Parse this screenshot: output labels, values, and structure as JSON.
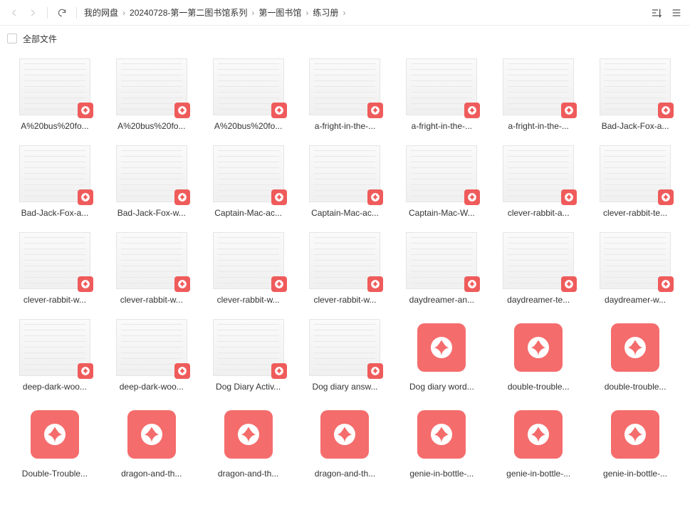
{
  "breadcrumb": {
    "root": "我的网盘",
    "p1": "20240728-第一第二图书馆系列",
    "p2": "第一图书馆",
    "p3": "练习册"
  },
  "selectbar": {
    "all_label": "全部文件"
  },
  "files": [
    {
      "name": "A%20bus%20fo...",
      "thumb": true
    },
    {
      "name": "A%20bus%20fo...",
      "thumb": true
    },
    {
      "name": "A%20bus%20fo...",
      "thumb": true
    },
    {
      "name": "a-fright-in-the-...",
      "thumb": true
    },
    {
      "name": "a-fright-in-the-...",
      "thumb": true
    },
    {
      "name": "a-fright-in-the-...",
      "thumb": true
    },
    {
      "name": "Bad-Jack-Fox-a...",
      "thumb": true
    },
    {
      "name": "Bad-Jack-Fox-a...",
      "thumb": true
    },
    {
      "name": "Bad-Jack-Fox-w...",
      "thumb": true
    },
    {
      "name": "Captain-Mac-ac...",
      "thumb": true
    },
    {
      "name": "Captain-Mac-ac...",
      "thumb": true
    },
    {
      "name": "Captain-Mac-W...",
      "thumb": true
    },
    {
      "name": "clever-rabbit-a...",
      "thumb": true
    },
    {
      "name": "clever-rabbit-te...",
      "thumb": true
    },
    {
      "name": "clever-rabbit-w...",
      "thumb": true
    },
    {
      "name": "clever-rabbit-w...",
      "thumb": true
    },
    {
      "name": "clever-rabbit-w...",
      "thumb": true
    },
    {
      "name": "clever-rabbit-w...",
      "thumb": true
    },
    {
      "name": "daydreamer-an...",
      "thumb": true
    },
    {
      "name": "daydreamer-te...",
      "thumb": true
    },
    {
      "name": "daydreamer-w...",
      "thumb": true
    },
    {
      "name": "deep-dark-woo...",
      "thumb": true
    },
    {
      "name": "deep-dark-woo...",
      "thumb": true
    },
    {
      "name": "Dog Diary Activ...",
      "thumb": true
    },
    {
      "name": "Dog diary answ...",
      "thumb": true
    },
    {
      "name": "Dog diary word...",
      "thumb": false
    },
    {
      "name": "double-trouble...",
      "thumb": false
    },
    {
      "name": "double-trouble...",
      "thumb": false
    },
    {
      "name": "Double-Trouble...",
      "thumb": false
    },
    {
      "name": "dragon-and-th...",
      "thumb": false
    },
    {
      "name": "dragon-and-th...",
      "thumb": false
    },
    {
      "name": "dragon-and-th...",
      "thumb": false
    },
    {
      "name": "genie-in-bottle-...",
      "thumb": false
    },
    {
      "name": "genie-in-bottle-...",
      "thumb": false
    },
    {
      "name": "genie-in-bottle-...",
      "thumb": false
    }
  ]
}
